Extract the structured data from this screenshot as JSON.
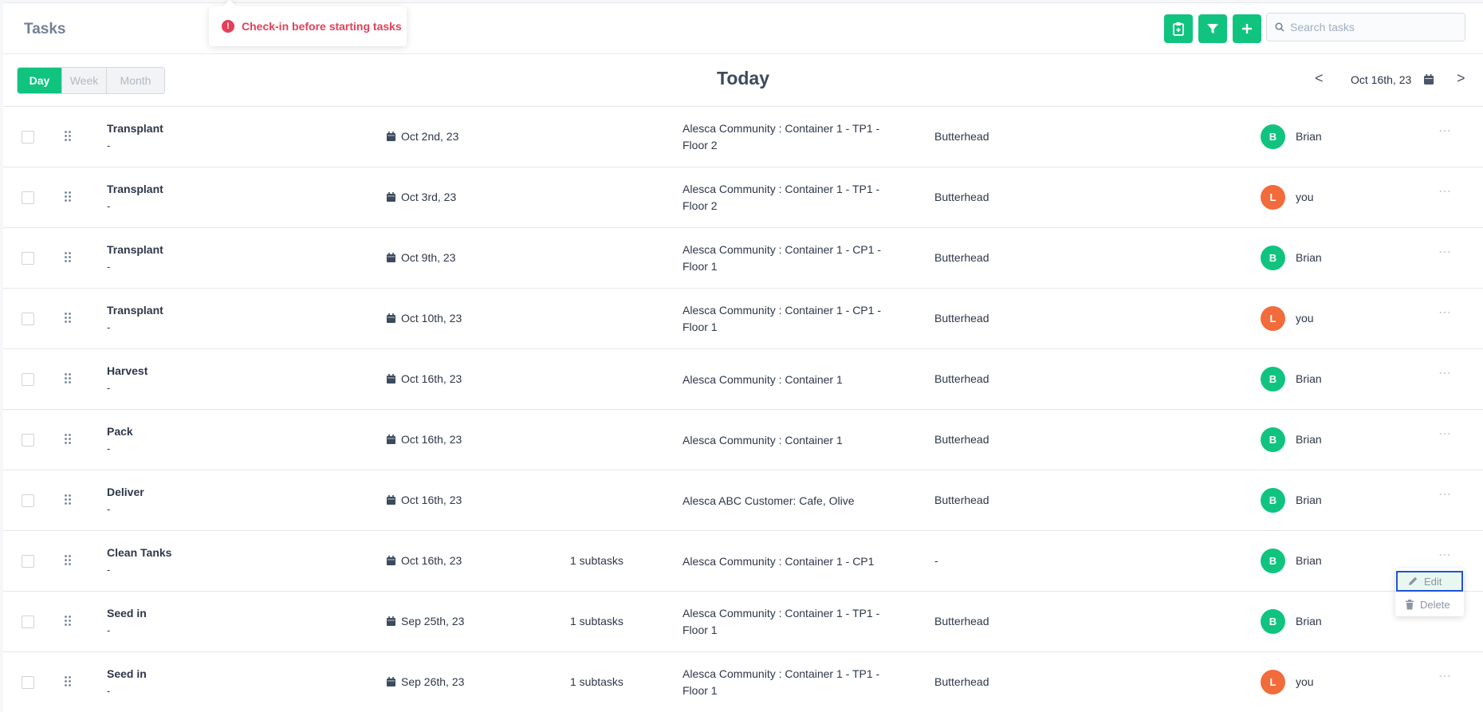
{
  "header": {
    "title": "Tasks",
    "toast_message": "Check-in before starting tasks",
    "search_placeholder": "Search tasks"
  },
  "toolbar": {
    "views": [
      "Day",
      "Week",
      "Month"
    ],
    "active_view": "Day",
    "heading": "Today",
    "prev_label": "<",
    "next_label": ">",
    "current_date": "Oct 16th, 23"
  },
  "colors": {
    "accent": "#10c47f",
    "alert": "#e53e5a",
    "avatar_b": "#10c47f",
    "avatar_l": "#f26b3a",
    "focus_outline": "#1f52d4"
  },
  "tasks": [
    {
      "name": "Transplant",
      "sub": "-",
      "date": "Oct 2nd, 23",
      "subtasks": "",
      "location": "Alesca Community : Container 1 - TP1 - Floor 2",
      "crop": "Butterhead",
      "avatar": "B",
      "assignee": "Brian"
    },
    {
      "name": "Transplant",
      "sub": "-",
      "date": "Oct 3rd, 23",
      "subtasks": "",
      "location": "Alesca Community : Container 1 - TP1 - Floor 2",
      "crop": "Butterhead",
      "avatar": "L",
      "assignee": "you"
    },
    {
      "name": "Transplant",
      "sub": "-",
      "date": "Oct 9th, 23",
      "subtasks": "",
      "location": "Alesca Community : Container 1 - CP1 - Floor 1",
      "crop": "Butterhead",
      "avatar": "B",
      "assignee": "Brian"
    },
    {
      "name": "Transplant",
      "sub": "-",
      "date": "Oct 10th, 23",
      "subtasks": "",
      "location": "Alesca Community : Container 1 - CP1 - Floor 1",
      "crop": "Butterhead",
      "avatar": "L",
      "assignee": "you"
    },
    {
      "name": "Harvest",
      "sub": "-",
      "date": "Oct 16th, 23",
      "subtasks": "",
      "location": "Alesca Community : Container 1",
      "crop": "Butterhead",
      "avatar": "B",
      "assignee": "Brian"
    },
    {
      "name": "Pack",
      "sub": "-",
      "date": "Oct 16th, 23",
      "subtasks": "",
      "location": "Alesca Community : Container 1",
      "crop": "Butterhead",
      "avatar": "B",
      "assignee": "Brian"
    },
    {
      "name": "Deliver",
      "sub": "-",
      "date": "Oct 16th, 23",
      "subtasks": "",
      "location": "Alesca ABC Customer: Cafe, Olive",
      "crop": "Butterhead",
      "avatar": "B",
      "assignee": "Brian"
    },
    {
      "name": "Clean Tanks",
      "sub": "-",
      "date": "Oct 16th, 23",
      "subtasks": "1 subtasks",
      "location": "Alesca Community : Container 1 - CP1",
      "crop": "-",
      "avatar": "B",
      "assignee": "Brian"
    },
    {
      "name": "Seed in",
      "sub": "-",
      "date": "Sep 25th, 23",
      "subtasks": "1 subtasks",
      "location": "Alesca Community : Container 1 - TP1 - Floor 1",
      "crop": "Butterhead",
      "avatar": "B",
      "assignee": "Brian"
    },
    {
      "name": "Seed in",
      "sub": "-",
      "date": "Sep 26th, 23",
      "subtasks": "1 subtasks",
      "location": "Alesca Community : Container 1 - TP1 - Floor 1",
      "crop": "Butterhead",
      "avatar": "L",
      "assignee": "you"
    }
  ],
  "row_menu": {
    "edit_label": "Edit",
    "delete_label": "Delete"
  }
}
